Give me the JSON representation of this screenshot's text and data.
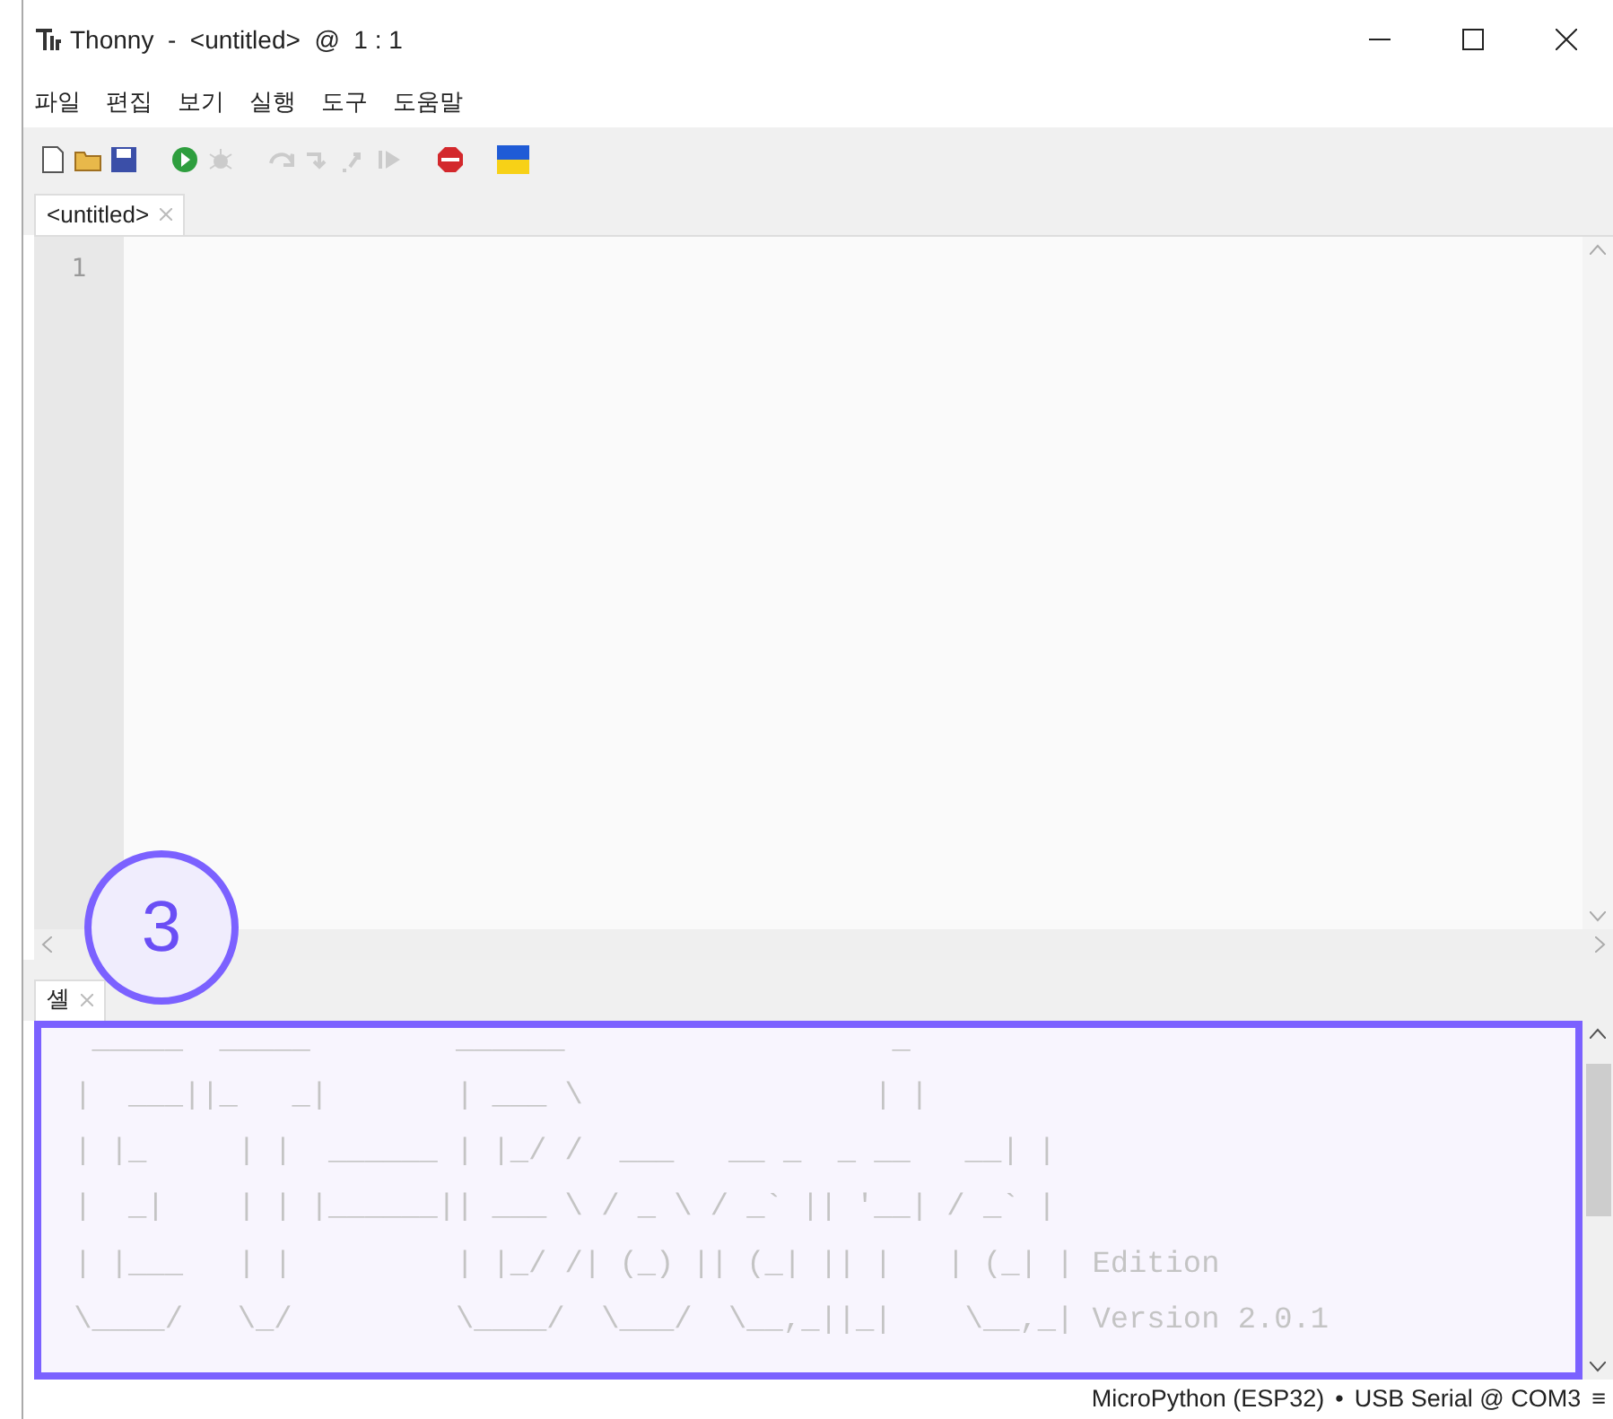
{
  "window": {
    "title": "Thonny  -  <untitled>  @  1 : 1"
  },
  "menu": [
    {
      "label": "파일"
    },
    {
      "label": "편집"
    },
    {
      "label": "보기"
    },
    {
      "label": "실행"
    },
    {
      "label": "도구"
    },
    {
      "label": "도움말"
    }
  ],
  "toolbar": [
    {
      "kind": "new",
      "disabled": false
    },
    {
      "kind": "open",
      "disabled": false
    },
    {
      "kind": "save",
      "disabled": false
    },
    {
      "kind": "run",
      "disabled": false
    },
    {
      "kind": "debug",
      "disabled": true
    },
    {
      "kind": "step-over",
      "disabled": true
    },
    {
      "kind": "step-into",
      "disabled": true
    },
    {
      "kind": "step-out",
      "disabled": true
    },
    {
      "kind": "resume",
      "disabled": true
    },
    {
      "kind": "stop",
      "disabled": false
    },
    {
      "kind": "flag",
      "disabled": false
    }
  ],
  "editor_tabs": [
    {
      "label": "<untitled>",
      "selected": true
    }
  ],
  "editor": {
    "line_numbers": [
      "1"
    ]
  },
  "shell_tabs": [
    {
      "label": "셸",
      "selected": true
    }
  ],
  "shell": {
    "banner_lines": [
      "  _____  _____        ______                  _",
      " |  ___||_   _|       | ___ \\                | |",
      " | |_     | |  ______ | |_/ /  ___   __ _  _ __   __| |",
      " |  _|    | | |______|| ___ \\ / _ \\ / _` || '__| / _` |",
      " | |___   | |         | |_/ /| (_) || (_| || |   | (_| | Edition",
      " \\____/   \\_/         \\____/  \\___/  \\__,_||_|    \\__,_| Version 2.0.1"
    ]
  },
  "status_bar": {
    "interpreter": "MicroPython (ESP32)",
    "separator": "•",
    "port": "USB Serial @ COM3",
    "menu": "≡"
  },
  "annotation": {
    "label": "3"
  }
}
